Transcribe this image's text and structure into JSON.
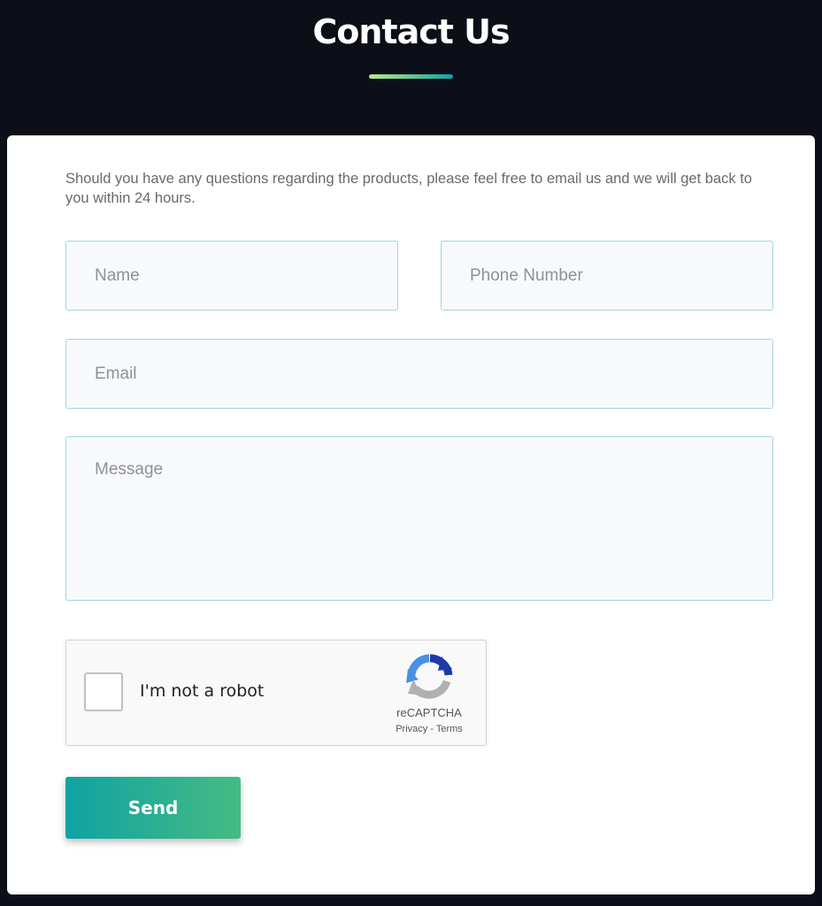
{
  "header": {
    "title": "Contact Us",
    "underline_gradient": [
      "#b8e986",
      "#0fa3a3"
    ]
  },
  "form": {
    "intro": "Should you have any questions regarding the products, please feel free to email us and we will get back to you within 24 hours.",
    "name_placeholder": "Name",
    "phone_placeholder": "Phone Number",
    "email_placeholder": "Email",
    "message_placeholder": "Message",
    "send_label": "Send",
    "send_gradient": [
      "#0fa3a3",
      "#45bb82"
    ]
  },
  "recaptcha": {
    "label": "I'm not a robot",
    "brand": "reCAPTCHA",
    "privacy_link": "Privacy",
    "separator": " - ",
    "terms_link": "Terms",
    "checked": false,
    "logo_icon": "recaptcha-logo-icon"
  },
  "colors": {
    "page_background": "#0c0f18",
    "card_background": "#ffffff",
    "field_border": "#9fd6e3",
    "field_background": "#f8f9fc"
  }
}
